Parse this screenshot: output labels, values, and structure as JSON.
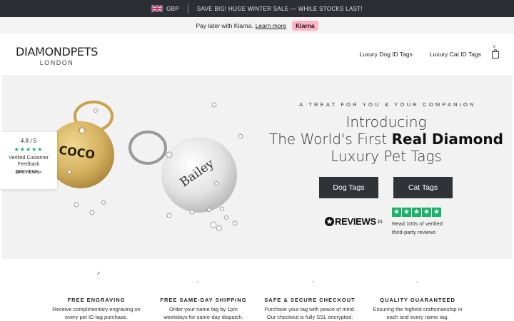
{
  "topbar": {
    "currency": "GBP",
    "sale_text": "SAVE BIG! HUGE WINTER SALE — WHILE STOCKS LAST!"
  },
  "klarna": {
    "text": "Pay later with Klarna.",
    "link": "Learn more",
    "badge": "Klarna"
  },
  "header": {
    "logo_main": "DIAMONDPETS",
    "logo_sub": "LONDON",
    "nav": [
      "Luxury Dog ID Tags",
      "Luxury Cat ID Tags"
    ],
    "cart_count": "0"
  },
  "hero": {
    "tagline": "A TREAT FOR YOU & YOUR COMPANION",
    "headline_line1": "Introducing",
    "headline_line2_pre": "The World's First ",
    "headline_line2_bold": "Real Diamond",
    "headline_line3": "Luxury Pet Tags",
    "btn_dog": "Dog Tags",
    "btn_cat": "Cat Tags",
    "reviews_logo": "REVIEWS",
    "reviews_logo_suffix": ".io",
    "reviews_text_1": "Read 100s of verified",
    "reviews_text_2": "third-party reviews",
    "tag_name_gold": "COCO",
    "tag_name_silver": "Bailey"
  },
  "rating_card": {
    "score": "4.8 / 5",
    "stars": "★★★★★",
    "label_1": "Verified Customer",
    "label_2": "Feedback",
    "logo": "REVIEWS",
    "logo_suffix": "io"
  },
  "features": [
    {
      "title": "FREE ENGRAVING",
      "desc_1": "Receive complimentary engraving on",
      "desc_2": "every pet ID tag purchase."
    },
    {
      "title": "FREE SAME-DAY SHIPPING",
      "desc_1": "Order your name tag by 1pm",
      "desc_2": "weekdays for same-day dispatch."
    },
    {
      "title": "SAFE & SECURE CHECKOUT",
      "desc_1": "Purchase your tag with peace of mind.",
      "desc_2": "Our checkout is fully SSL encrypted."
    },
    {
      "title": "QUALITY GUARANTEED",
      "desc_1": "Ensuring the highest craftsmanship in",
      "desc_2": "each and every name tag."
    }
  ],
  "colors": {
    "topbar_bg": "#2b2e33",
    "button_bg": "#2f3337",
    "klarna_pink": "#ffb3c7",
    "review_green": "#19b36b",
    "gold": "#d4b15f",
    "silver": "#dcdcdc"
  }
}
